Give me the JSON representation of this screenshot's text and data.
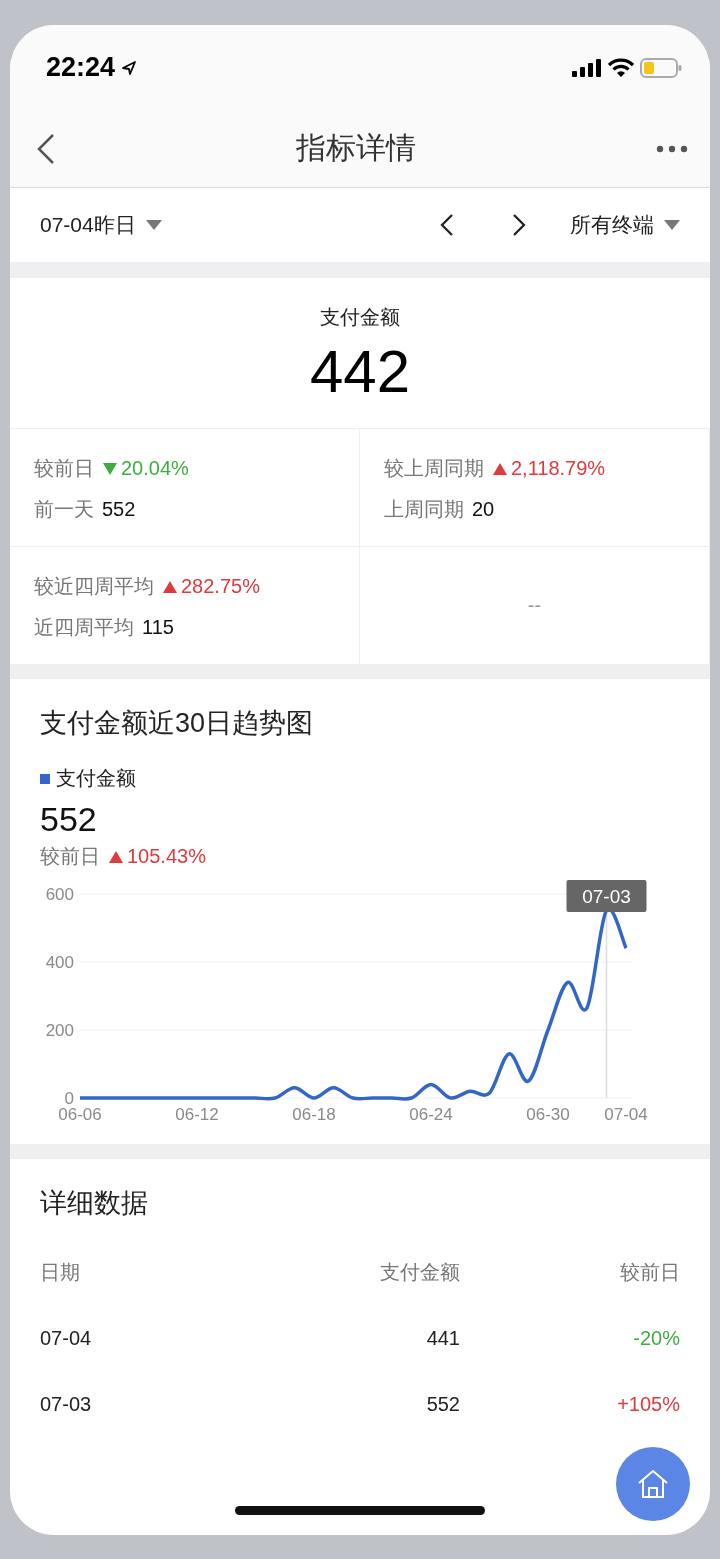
{
  "status_bar": {
    "time": "22:24"
  },
  "nav": {
    "title": "指标详情"
  },
  "filter": {
    "date": "07-04昨日",
    "terminal": "所有终端"
  },
  "summary": {
    "title": "支付金额",
    "value": "442",
    "metrics": [
      {
        "kind": "metric",
        "label": "较前日",
        "rising": false,
        "change": "20.04%",
        "sub_label": "前一天",
        "sub_value": "552"
      },
      {
        "kind": "metric",
        "label": "较上周同期",
        "rising": true,
        "change": "2,118.79%",
        "sub_label": "上周同期",
        "sub_value": "20"
      },
      {
        "kind": "metric",
        "label": "较近四周平均",
        "rising": true,
        "change": "282.75%",
        "sub_label": "近四周平均",
        "sub_value": "115"
      },
      {
        "kind": "empty",
        "text": "--"
      }
    ]
  },
  "trend": {
    "title": "支付金额近30日趋势图",
    "value": "552",
    "compare_label": "较前日",
    "compare_rising": true,
    "compare_change": "105.43%",
    "chart_data": {
      "type": "line",
      "categories": [
        "06-06",
        null,
        null,
        null,
        null,
        null,
        "06-12",
        null,
        null,
        null,
        null,
        null,
        "06-18",
        null,
        null,
        null,
        null,
        null,
        "06-24",
        null,
        null,
        null,
        null,
        null,
        "06-30",
        null,
        null,
        null,
        "07-04"
      ],
      "series": [
        {
          "name": "支付金额",
          "color": "#3266c8",
          "values": [
            0,
            0,
            0,
            0,
            0,
            0,
            0,
            0,
            0,
            0,
            0,
            30,
            0,
            30,
            0,
            0,
            0,
            0,
            40,
            0,
            20,
            15,
            130,
            50,
            200,
            340,
            265,
            552,
            441
          ]
        }
      ],
      "ylim": [
        0,
        600
      ],
      "yticks": [
        0,
        200,
        400,
        600
      ],
      "annotations": [
        {
          "text": "07-03"
        }
      ]
    }
  },
  "details": {
    "title": "详细数据",
    "columns": [
      "日期",
      "支付金额",
      "较前日"
    ],
    "rows": [
      {
        "date": "07-04",
        "amount": "441",
        "change": "-20%",
        "rising": false
      },
      {
        "date": "07-03",
        "amount": "552",
        "change": "+105%",
        "rising": true
      }
    ]
  }
}
